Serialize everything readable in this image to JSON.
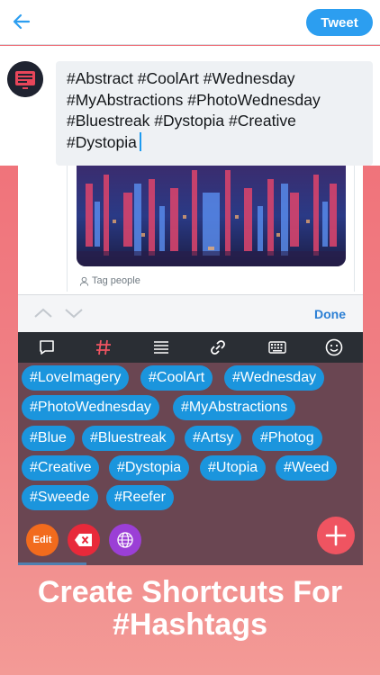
{
  "header": {
    "tweet_button": "Tweet",
    "back_icon": "back-arrow-icon"
  },
  "compose": {
    "lines": [
      "#Abstract #CoolArt #Wednesday",
      "#MyAbstractions #PhotoWednesday",
      "#Bluestreak #Dystopia #Creative",
      "#Dystopia"
    ]
  },
  "tweet_card": {
    "tag_people": "Tag people"
  },
  "keyboard_toolbar": {
    "done": "Done"
  },
  "tabs": [
    "speech-bubble-icon",
    "hashtag-icon",
    "list-icon",
    "link-icon",
    "keyboard-icon",
    "smiley-icon"
  ],
  "hashtags": [
    "#LoveImagery",
    "#CoolArt",
    "#Wednesday",
    "#PhotoWednesday",
    "#MyAbstractions",
    "#Blue",
    "#Bluestreak",
    "#Artsy",
    "#Photog",
    "#Creative",
    "#Dystopia",
    "#Utopia",
    "#Weed",
    "#Sweede",
    "#Reefer"
  ],
  "actions": {
    "edit": "Edit"
  },
  "caption": {
    "line1": "Create Shortcuts For",
    "line2": "#Hashtags"
  },
  "colors": {
    "accent": "#2c9ef0",
    "chip": "#1b95dd",
    "tag_panel": "#6a4652",
    "edit": "#f26b1d",
    "delete": "#e8293a",
    "globe": "#9b3fd6",
    "add": "#ef5461"
  }
}
